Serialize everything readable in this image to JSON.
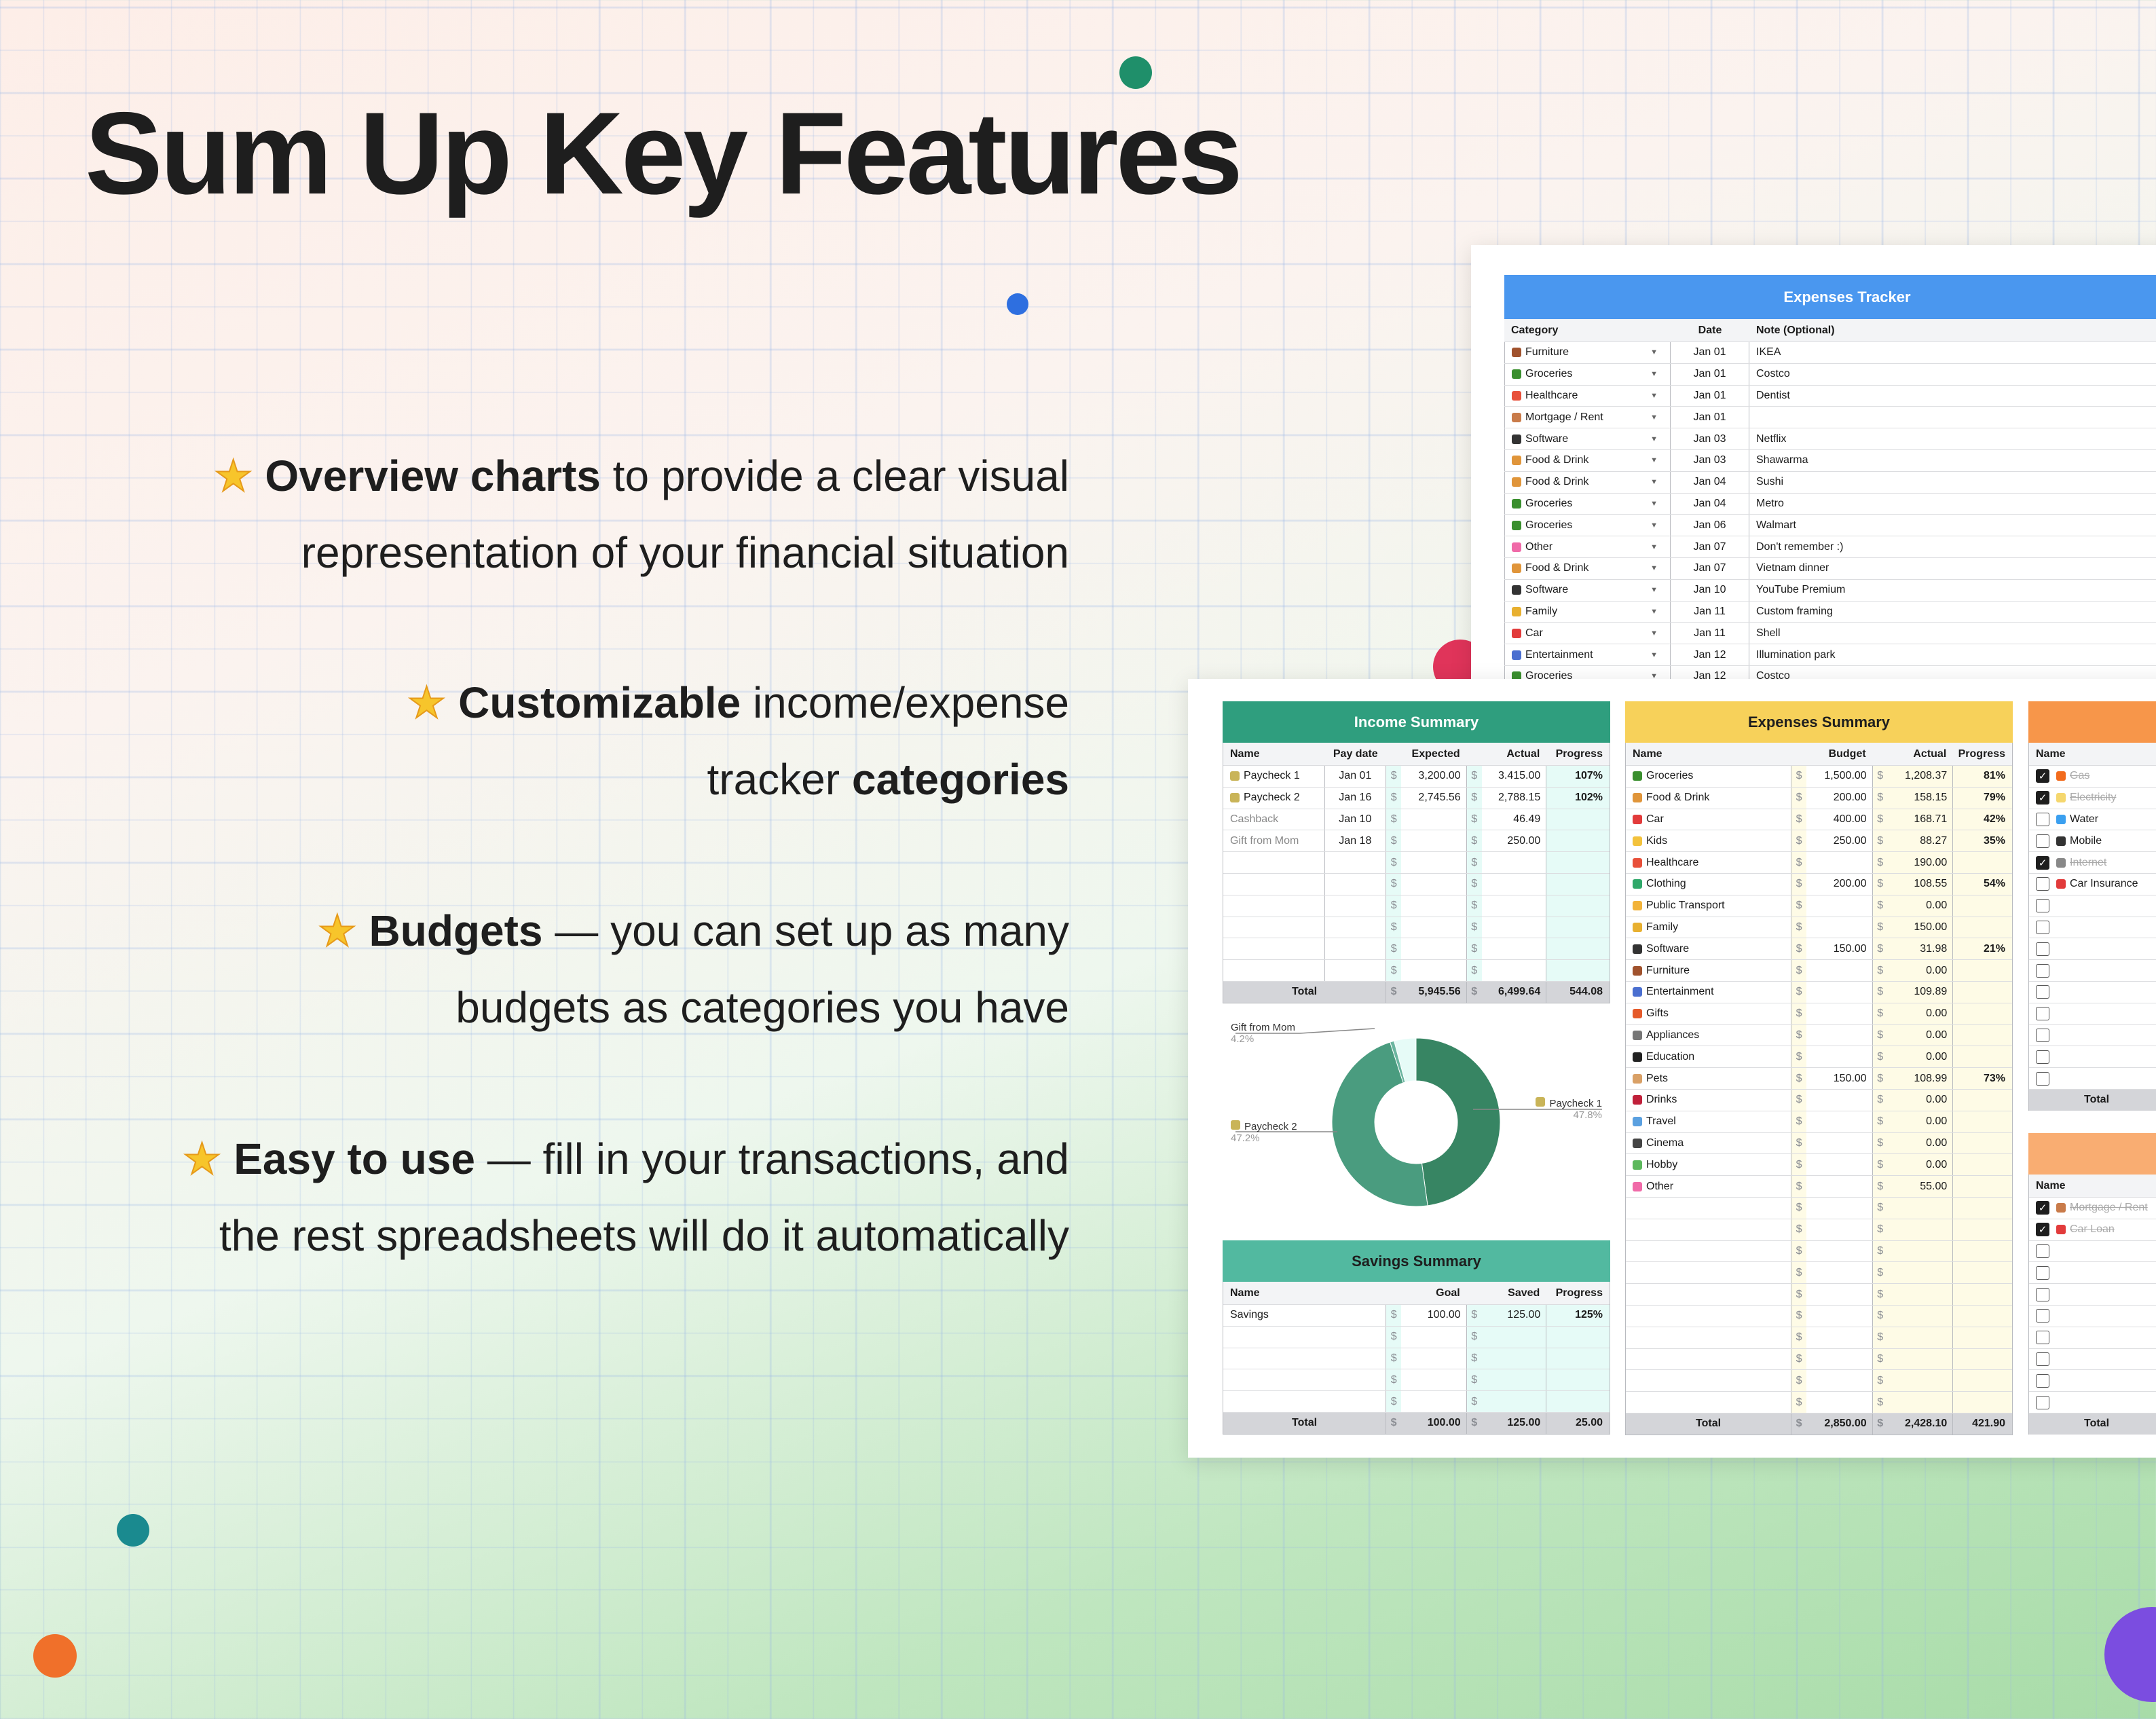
{
  "title": "Sum Up Key Features",
  "features": [
    {
      "lines": [
        [
          {
            "t": "Overview charts",
            "b": true
          },
          {
            "t": " to provide a clear visual",
            "b": false
          }
        ],
        [
          {
            "t": "representation of your financial situation",
            "b": false
          }
        ]
      ]
    },
    {
      "lines": [
        [
          {
            "t": "Customizable",
            "b": true
          },
          {
            "t": " income/expense",
            "b": false
          }
        ],
        [
          {
            "t": "tracker ",
            "b": false
          },
          {
            "t": "categories",
            "b": true
          }
        ]
      ]
    },
    {
      "lines": [
        [
          {
            "t": "Budgets",
            "b": true
          },
          {
            "t": " — you can set up as many",
            "b": false
          }
        ],
        [
          {
            "t": "budgets as categories you have",
            "b": false
          }
        ]
      ]
    },
    {
      "lines": [
        [
          {
            "t": "Easy to use",
            "b": true
          },
          {
            "t": " — fill in your transactions, and",
            "b": false
          }
        ],
        [
          {
            "t": "the rest spreadsheets will do it automatically",
            "b": false
          }
        ]
      ]
    }
  ],
  "star_icon": "star-icon",
  "colors": {
    "tracker": "#4a97ef",
    "income": "#2f9e7e",
    "savings": "#52b9a0",
    "expenses": "#f7d15a",
    "bills": "#f7964a",
    "debts": "#f9ad72",
    "total_row": "#d4d5d9"
  },
  "tracker": {
    "title": "Expenses Tracker",
    "headers": {
      "category": "Category",
      "date": "Date",
      "note": "Note (Optional)"
    },
    "rows": [
      {
        "icon": "furniture",
        "category": "Furniture",
        "date": "Jan 01",
        "note": "IKEA"
      },
      {
        "icon": "groceries",
        "category": "Groceries",
        "date": "Jan 01",
        "note": "Costco"
      },
      {
        "icon": "healthcare",
        "category": "Healthcare",
        "date": "Jan 01",
        "note": "Dentist"
      },
      {
        "icon": "mortgage",
        "category": "Mortgage / Rent",
        "date": "Jan 01",
        "note": ""
      },
      {
        "icon": "software",
        "category": "Software",
        "date": "Jan 03",
        "note": "Netflix"
      },
      {
        "icon": "food",
        "category": "Food & Drink",
        "date": "Jan 03",
        "note": "Shawarma"
      },
      {
        "icon": "food",
        "category": "Food & Drink",
        "date": "Jan 04",
        "note": "Sushi"
      },
      {
        "icon": "groceries",
        "category": "Groceries",
        "date": "Jan 04",
        "note": "Metro"
      },
      {
        "icon": "groceries",
        "category": "Groceries",
        "date": "Jan 06",
        "note": "Walmart"
      },
      {
        "icon": "other",
        "category": "Other",
        "date": "Jan 07",
        "note": "Don't remember :)"
      },
      {
        "icon": "food",
        "category": "Food & Drink",
        "date": "Jan 07",
        "note": "Vietnam dinner"
      },
      {
        "icon": "software",
        "category": "Software",
        "date": "Jan 10",
        "note": "YouTube Premium"
      },
      {
        "icon": "family",
        "category": "Family",
        "date": "Jan 11",
        "note": "Custom framing"
      },
      {
        "icon": "car",
        "category": "Car",
        "date": "Jan 11",
        "note": "Shell"
      },
      {
        "icon": "entertainment",
        "category": "Entertainment",
        "date": "Jan 12",
        "note": "Illumination park"
      },
      {
        "icon": "groceries",
        "category": "Groceries",
        "date": "Jan 12",
        "note": "Costco"
      }
    ]
  },
  "income": {
    "title": "Income Summary",
    "currency": "$",
    "headers": {
      "name": "Name",
      "pay_date": "Pay date",
      "expected": "Expected",
      "actual": "Actual",
      "progress": "Progress"
    },
    "rows": [
      {
        "icon": "money",
        "name": "Paycheck 1",
        "pay_date": "Jan 01",
        "expected": "3,200.00",
        "actual": "3.415.00",
        "progress": "107%"
      },
      {
        "icon": "money",
        "name": "Paycheck 2",
        "pay_date": "Jan 16",
        "expected": "2,745.56",
        "actual": "2,788.15",
        "progress": "102%"
      },
      {
        "icon": "",
        "name": "Cashback",
        "pay_date": "Jan 10",
        "expected": "",
        "actual": "46.49",
        "progress": ""
      },
      {
        "icon": "",
        "name": "Gift from Mom",
        "pay_date": "Jan 18",
        "expected": "",
        "actual": "250.00",
        "progress": ""
      },
      {
        "icon": "",
        "name": "",
        "pay_date": "",
        "expected": "",
        "actual": "",
        "progress": ""
      },
      {
        "icon": "",
        "name": "",
        "pay_date": "",
        "expected": "",
        "actual": "",
        "progress": ""
      },
      {
        "icon": "",
        "name": "",
        "pay_date": "",
        "expected": "",
        "actual": "",
        "progress": ""
      },
      {
        "icon": "",
        "name": "",
        "pay_date": "",
        "expected": "",
        "actual": "",
        "progress": ""
      },
      {
        "icon": "",
        "name": "",
        "pay_date": "",
        "expected": "",
        "actual": "",
        "progress": ""
      },
      {
        "icon": "",
        "name": "",
        "pay_date": "",
        "expected": "",
        "actual": "",
        "progress": ""
      }
    ],
    "total": {
      "label": "Total",
      "expected": "5,945.56",
      "actual": "6,499.64",
      "progress": "544.08"
    }
  },
  "chart_data": {
    "type": "pie",
    "donut": true,
    "slices": [
      {
        "name": "Paycheck 1",
        "value": 47.8,
        "label": "47.8%",
        "icon": "money",
        "color": "#378563"
      },
      {
        "name": "Paycheck 2",
        "value": 47.2,
        "label": "47.2%",
        "icon": "money",
        "color": "#4a9c7f"
      },
      {
        "name": "",
        "value": 0.8,
        "label": "",
        "icon": "",
        "color": "#6bb5a0"
      },
      {
        "name": "Gift from Mom",
        "value": 4.2,
        "label": "4.2%",
        "icon": "",
        "color": "#e6fbf7"
      }
    ]
  },
  "savings": {
    "title": "Savings Summary",
    "currency": "$",
    "headers": {
      "name": "Name",
      "goal": "Goal",
      "saved": "Saved",
      "progress": "Progress"
    },
    "rows": [
      {
        "name": "Savings",
        "goal": "100.00",
        "saved": "125.00",
        "progress": "125%"
      },
      {
        "name": "",
        "goal": "",
        "saved": "",
        "progress": ""
      },
      {
        "name": "",
        "goal": "",
        "saved": "",
        "progress": ""
      },
      {
        "name": "",
        "goal": "",
        "saved": "",
        "progress": ""
      },
      {
        "name": "",
        "goal": "",
        "saved": "",
        "progress": ""
      }
    ],
    "total": {
      "label": "Total",
      "goal": "100.00",
      "saved": "125.00",
      "progress": "25.00"
    }
  },
  "expenses": {
    "title": "Expenses Summary",
    "currency": "$",
    "headers": {
      "name": "Name",
      "budget": "Budget",
      "actual": "Actual",
      "progress": "Progress"
    },
    "rows": [
      {
        "icon": "groceries",
        "name": "Groceries",
        "budget": "1,500.00",
        "actual": "1,208.37",
        "progress": "81%"
      },
      {
        "icon": "food",
        "name": "Food & Drink",
        "budget": "200.00",
        "actual": "158.15",
        "progress": "79%"
      },
      {
        "icon": "car",
        "name": "Car",
        "budget": "400.00",
        "actual": "168.71",
        "progress": "42%"
      },
      {
        "icon": "kids",
        "name": "Kids",
        "budget": "250.00",
        "actual": "88.27",
        "progress": "35%"
      },
      {
        "icon": "healthcare",
        "name": "Healthcare",
        "budget": "",
        "actual": "190.00",
        "progress": ""
      },
      {
        "icon": "clothing",
        "name": "Clothing",
        "budget": "200.00",
        "actual": "108.55",
        "progress": "54%"
      },
      {
        "icon": "bus",
        "name": "Public Transport",
        "budget": "",
        "actual": "0.00",
        "progress": ""
      },
      {
        "icon": "family",
        "name": "Family",
        "budget": "",
        "actual": "150.00",
        "progress": ""
      },
      {
        "icon": "software",
        "name": "Software",
        "budget": "150.00",
        "actual": "31.98",
        "progress": "21%"
      },
      {
        "icon": "furniture",
        "name": "Furniture",
        "budget": "",
        "actual": "0.00",
        "progress": ""
      },
      {
        "icon": "entertainment",
        "name": "Entertainment",
        "budget": "",
        "actual": "109.89",
        "progress": ""
      },
      {
        "icon": "gifts",
        "name": "Gifts",
        "budget": "",
        "actual": "0.00",
        "progress": ""
      },
      {
        "icon": "appliances",
        "name": "Appliances",
        "budget": "",
        "actual": "0.00",
        "progress": ""
      },
      {
        "icon": "education",
        "name": "Education",
        "budget": "",
        "actual": "0.00",
        "progress": ""
      },
      {
        "icon": "pets",
        "name": "Pets",
        "budget": "150.00",
        "actual": "108.99",
        "progress": "73%"
      },
      {
        "icon": "drinks",
        "name": "Drinks",
        "budget": "",
        "actual": "0.00",
        "progress": ""
      },
      {
        "icon": "travel",
        "name": "Travel",
        "budget": "",
        "actual": "0.00",
        "progress": ""
      },
      {
        "icon": "cinema",
        "name": "Cinema",
        "budget": "",
        "actual": "0.00",
        "progress": ""
      },
      {
        "icon": "hobby",
        "name": "Hobby",
        "budget": "",
        "actual": "0.00",
        "progress": ""
      },
      {
        "icon": "other",
        "name": "Other",
        "budget": "",
        "actual": "55.00",
        "progress": ""
      },
      {
        "icon": "",
        "name": "",
        "budget": "",
        "actual": "",
        "progress": ""
      },
      {
        "icon": "",
        "name": "",
        "budget": "",
        "actual": "",
        "progress": ""
      },
      {
        "icon": "",
        "name": "",
        "budget": "",
        "actual": "",
        "progress": ""
      },
      {
        "icon": "",
        "name": "",
        "budget": "",
        "actual": "",
        "progress": ""
      },
      {
        "icon": "",
        "name": "",
        "budget": "",
        "actual": "",
        "progress": ""
      },
      {
        "icon": "",
        "name": "",
        "budget": "",
        "actual": "",
        "progress": ""
      },
      {
        "icon": "",
        "name": "",
        "budget": "",
        "actual": "",
        "progress": ""
      },
      {
        "icon": "",
        "name": "",
        "budget": "",
        "actual": "",
        "progress": ""
      },
      {
        "icon": "",
        "name": "",
        "budget": "",
        "actual": "",
        "progress": ""
      },
      {
        "icon": "",
        "name": "",
        "budget": "",
        "actual": "",
        "progress": ""
      }
    ],
    "total": {
      "label": "Total",
      "budget": "2,850.00",
      "actual": "2,428.10",
      "progress": "421.90"
    }
  },
  "bills": {
    "headers": {
      "name": "Name"
    },
    "rows": [
      {
        "checked": true,
        "icon": "gas",
        "name": "Gas"
      },
      {
        "checked": true,
        "icon": "electricity",
        "name": "Electricity"
      },
      {
        "checked": false,
        "icon": "water",
        "name": "Water"
      },
      {
        "checked": false,
        "icon": "mobile",
        "name": "Mobile"
      },
      {
        "checked": true,
        "icon": "internet",
        "name": "Internet"
      },
      {
        "checked": false,
        "icon": "car",
        "name": "Car Insurance"
      },
      {
        "checked": false,
        "icon": "",
        "name": ""
      },
      {
        "checked": false,
        "icon": "",
        "name": ""
      },
      {
        "checked": false,
        "icon": "",
        "name": ""
      },
      {
        "checked": false,
        "icon": "",
        "name": ""
      },
      {
        "checked": false,
        "icon": "",
        "name": ""
      },
      {
        "checked": false,
        "icon": "",
        "name": ""
      },
      {
        "checked": false,
        "icon": "",
        "name": ""
      },
      {
        "checked": false,
        "icon": "",
        "name": ""
      },
      {
        "checked": false,
        "icon": "",
        "name": ""
      }
    ],
    "total": {
      "label": "Total"
    }
  },
  "debts": {
    "headers": {
      "name": "Name"
    },
    "rows": [
      {
        "checked": true,
        "icon": "mortgage",
        "name": "Mortgage / Rent"
      },
      {
        "checked": true,
        "icon": "car",
        "name": "Car Loan"
      },
      {
        "checked": false,
        "icon": "",
        "name": ""
      },
      {
        "checked": false,
        "icon": "",
        "name": ""
      },
      {
        "checked": false,
        "icon": "",
        "name": ""
      },
      {
        "checked": false,
        "icon": "",
        "name": ""
      },
      {
        "checked": false,
        "icon": "",
        "name": ""
      },
      {
        "checked": false,
        "icon": "",
        "name": ""
      },
      {
        "checked": false,
        "icon": "",
        "name": ""
      },
      {
        "checked": false,
        "icon": "",
        "name": ""
      }
    ],
    "total": {
      "label": "Total"
    }
  }
}
